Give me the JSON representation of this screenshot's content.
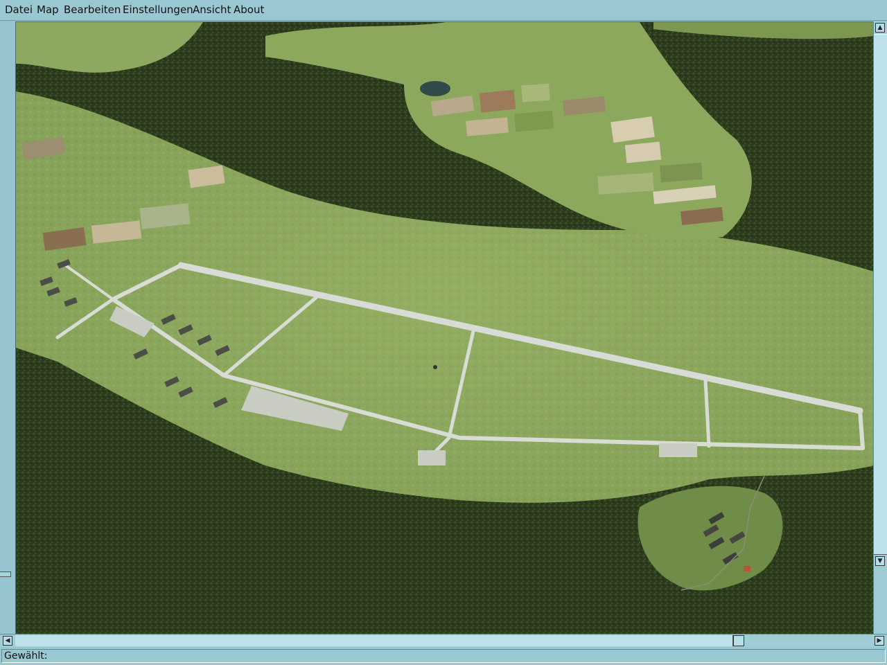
{
  "menubar": {
    "items": [
      "Datei",
      "Map",
      "Bearbeiten",
      "Einstellungen",
      "Ansicht",
      "About"
    ]
  },
  "statusbar": {
    "label": "Gewählt:"
  },
  "scrollbars": {
    "up_arrow": "▲",
    "down_arrow": "▼",
    "left_arrow": "◀",
    "right_arrow": "▶"
  },
  "icons": {
    "scroll_up": "triangle-up",
    "scroll_down": "triangle-down",
    "scroll_left": "triangle-left",
    "scroll_right": "triangle-right"
  },
  "colors": {
    "chrome": "#9ac8d2",
    "forest": "#2a3a1a",
    "meadow": "#7a9a4a",
    "runway": "#d8dbd4"
  }
}
